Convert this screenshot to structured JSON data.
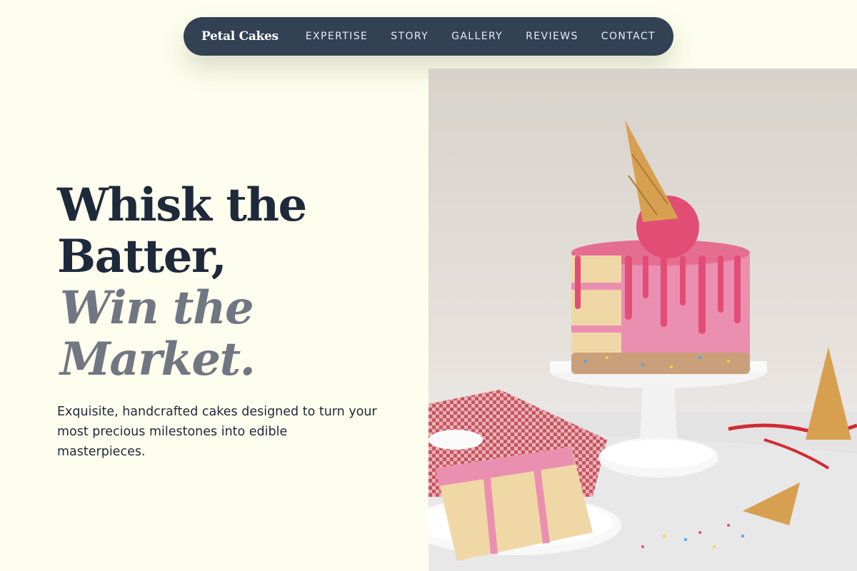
{
  "nav": {
    "brand": "Petal Cakes",
    "links": [
      "EXPERTISE",
      "STORY",
      "GALLERY",
      "REVIEWS",
      "CONTACT"
    ]
  },
  "hero": {
    "title_line1": "Whisk the",
    "title_line2": "Batter,",
    "title_line3": "Win the",
    "title_line4": "Market.",
    "subtitle": "Exquisite, handcrafted cakes designed to turn your most precious milestones into edible masterpieces."
  },
  "image": {
    "subject": "pink drip funfetti cake with ice cream cone topper on white cake stand"
  },
  "colors": {
    "background": "#fefeee",
    "nav_bg": "#334155",
    "title": "#1e293b",
    "accent_title": "#707782",
    "frosting": "#e56d91"
  }
}
